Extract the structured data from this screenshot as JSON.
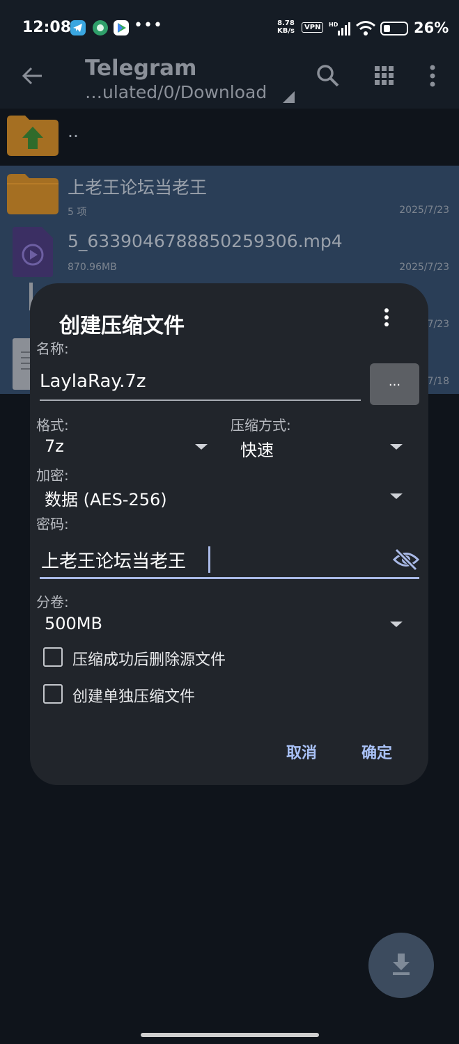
{
  "status_bar": {
    "time": "12:08",
    "net_speed_value": "8.78",
    "net_speed_unit": "KB/s",
    "vpn": "VPN",
    "hd": "HD",
    "battery_pct": "26%"
  },
  "app_bar": {
    "title": "Telegram",
    "path": "…ulated/0/Download"
  },
  "file_list": {
    "parent": "..",
    "items": [
      {
        "name": "上老王论坛当老王",
        "meta": "5 项",
        "date": "2025/7/23",
        "kind": "folder"
      },
      {
        "name": "5_6339046788850259306.mp4",
        "meta": "870.96MB",
        "date": "2025/7/23",
        "kind": "video"
      },
      {
        "name": "",
        "meta": "",
        "date": "7/23",
        "kind": "archive"
      },
      {
        "name": "",
        "meta": "",
        "date": "7/18",
        "kind": "document"
      }
    ]
  },
  "dialog": {
    "title": "创建压缩文件",
    "name_label": "名称:",
    "name_value": "LaylaRay.7z",
    "browse_label": "...",
    "format_label": "格式:",
    "format_value": "7z",
    "method_label": "压缩方式:",
    "method_value": "快速",
    "encrypt_label": "加密:",
    "encrypt_value": "数据 (AES-256)",
    "password_label": "密码:",
    "password_value": "上老王论坛当老王",
    "split_label": "分卷:",
    "split_value": "500MB",
    "delete_source_label": "压缩成功后删除源文件",
    "delete_source_checked": false,
    "separate_label": "创建单独压缩文件",
    "separate_checked": false,
    "cancel_label": "取消",
    "ok_label": "确定"
  },
  "colors": {
    "accent": "#a9c2f7",
    "dialog_bg": "#21252b",
    "folder": "#c98a2b",
    "selected_row": "#2a3e57"
  }
}
